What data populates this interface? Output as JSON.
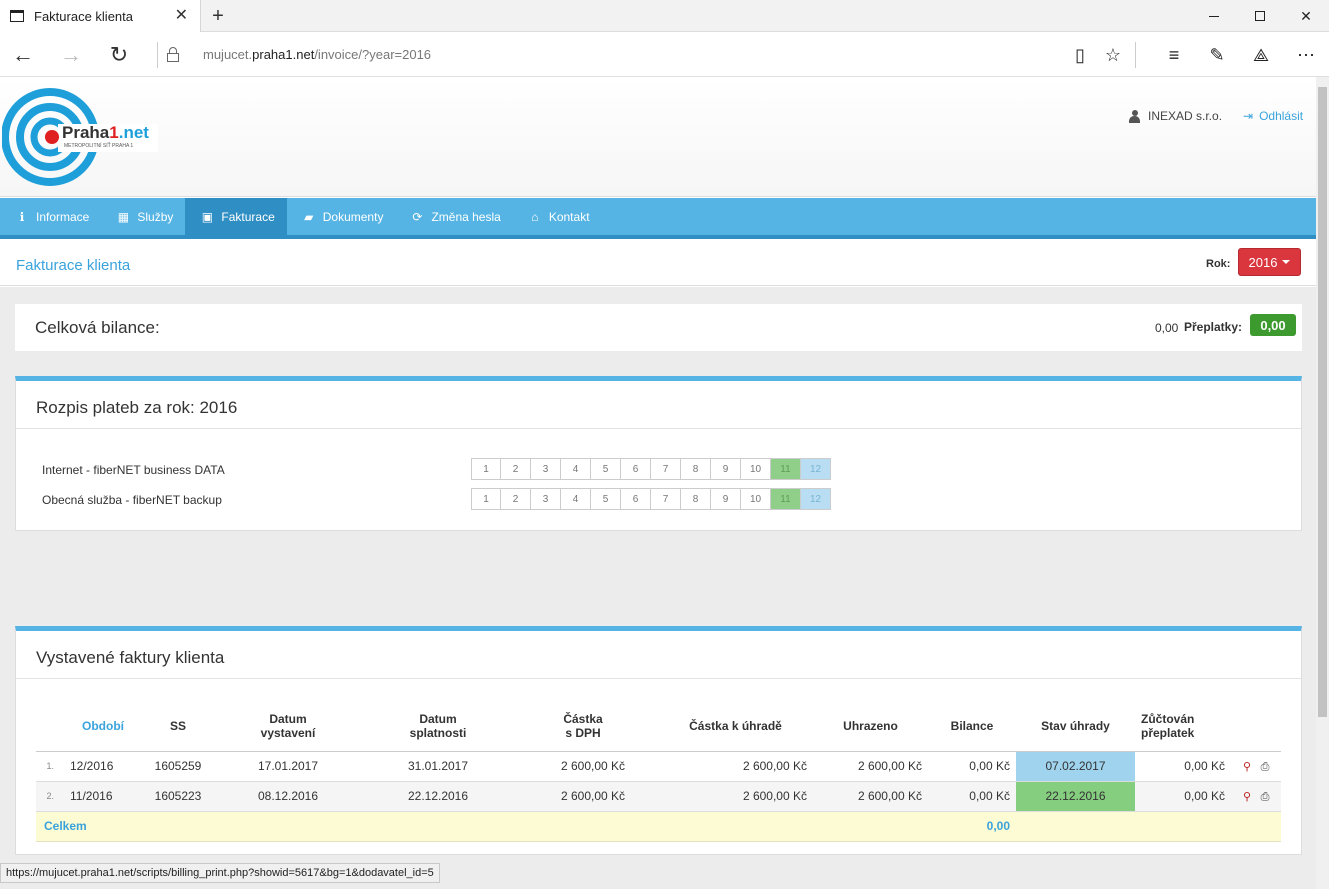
{
  "browser": {
    "tab_title": "Fakturace klienta",
    "url_host_prefix": "mujucet.",
    "url_host": "praha1.net",
    "url_path": "/invoice/?year=2016",
    "status_url": "https://mujucet.praha1.net/scripts/billing_print.php?showid=5617&bg=1&dodavatel_id=5"
  },
  "header": {
    "logo_text_a": "Praha",
    "logo_text_b": "1",
    "logo_text_c": ".net",
    "logo_sub": "METROPOLITNÍ SÍŤ PRAHA 1",
    "user": "INEXAD s.r.o.",
    "logout": "Odhlásit"
  },
  "menu": {
    "items": [
      {
        "label": "Informace",
        "icon": "info-icon"
      },
      {
        "label": "Služby",
        "icon": "grid-icon"
      },
      {
        "label": "Fakturace",
        "icon": "money-icon"
      },
      {
        "label": "Dokumenty",
        "icon": "folder-icon"
      },
      {
        "label": "Změna hesla",
        "icon": "refresh-icon"
      },
      {
        "label": "Kontakt",
        "icon": "home-icon"
      }
    ],
    "active": "Fakturace"
  },
  "subheader": {
    "title": "Fakturace klienta",
    "rok_label": "Rok:",
    "year": "2016"
  },
  "balance": {
    "label": "Celková bilance:",
    "value": "0,00",
    "overpay_label": "Přeplatky:",
    "overpay_value": "0,00"
  },
  "payments": {
    "title": "Rozpis plateb za rok: 2016",
    "rows": [
      {
        "service": "Internet - fiberNET business DATA"
      },
      {
        "service": "Obecná služba - fiberNET backup"
      }
    ],
    "months": [
      "1",
      "2",
      "3",
      "4",
      "5",
      "6",
      "7",
      "8",
      "9",
      "10",
      "11",
      "12"
    ],
    "month_state": [
      "",
      "",
      "",
      "",
      "",
      "",
      "",
      "",
      "",
      "",
      "paid",
      "pending"
    ]
  },
  "invoices": {
    "title": "Vystavené faktury klienta",
    "headers": {
      "obdobi": "Období",
      "ss": "SS",
      "datum_vystaveni_1": "Datum",
      "datum_vystaveni_2": "vystavení",
      "datum_splatnosti_1": "Datum",
      "datum_splatnosti_2": "splatnosti",
      "castka_1": "Částka",
      "castka_2": "s DPH",
      "k_uhrade": "Částka k úhradě",
      "uhrazeno": "Uhrazeno",
      "bilance": "Bilance",
      "stav": "Stav úhrady",
      "zuctovan_1": "Zůčtován",
      "zuctovan_2": "přeplatek"
    },
    "rows": [
      {
        "n": "1.",
        "obdobi": "12/2016",
        "ss": "1605259",
        "vystaveni": "17.01.2017",
        "splatnost": "31.01.2017",
        "castka": "2 600,00 Kč",
        "k_uhrade": "2 600,00 Kč",
        "uhrazeno": "2 600,00 Kč",
        "bilance": "0,00 Kč",
        "stav": "07.02.2017",
        "zuctovan": "0,00 Kč"
      },
      {
        "n": "2.",
        "obdobi": "11/2016",
        "ss": "1605223",
        "vystaveni": "08.12.2016",
        "splatnost": "22.12.2016",
        "castka": "2 600,00 Kč",
        "k_uhrade": "2 600,00 Kč",
        "uhrazeno": "2 600,00 Kč",
        "bilance": "0,00 Kč",
        "stav": "22.12.2016",
        "zuctovan": "0,00 Kč"
      }
    ],
    "total_label": "Celkem",
    "total_bilance": "0,00"
  },
  "colors": {
    "accent": "#55b4e4",
    "active_menu": "#2f8fc4",
    "year_button": "#d9363e",
    "paid": "#85cd7f",
    "pending": "#9fd3ee",
    "badge": "#3c9a2f"
  }
}
